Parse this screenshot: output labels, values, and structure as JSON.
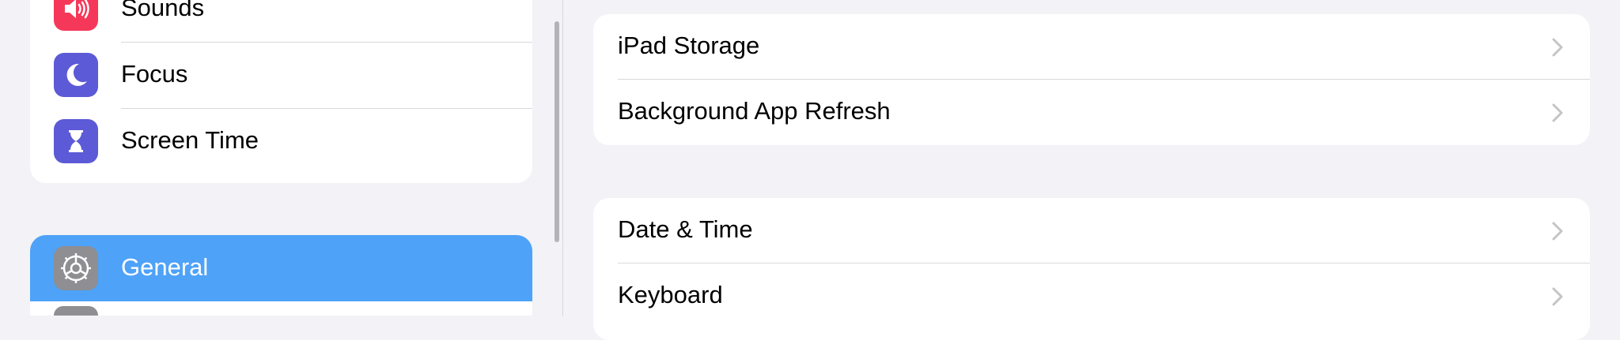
{
  "sidebar": {
    "items": [
      {
        "label": "Sounds",
        "icon": "speaker-icon",
        "icon_color": "#f5385a"
      },
      {
        "label": "Focus",
        "icon": "moon-icon",
        "icon_color": "#5c5ad6"
      },
      {
        "label": "Screen Time",
        "icon": "hourglass-icon",
        "icon_color": "#5c5ad6"
      }
    ],
    "selected": {
      "label": "General",
      "icon": "gear-icon",
      "icon_color": "#8e8e93",
      "highlight_color": "#4ea2f8"
    }
  },
  "detail": {
    "group1": [
      {
        "label": "iPad Storage"
      },
      {
        "label": "Background App Refresh"
      }
    ],
    "group2": [
      {
        "label": "Date & Time"
      },
      {
        "label": "Keyboard"
      }
    ]
  }
}
